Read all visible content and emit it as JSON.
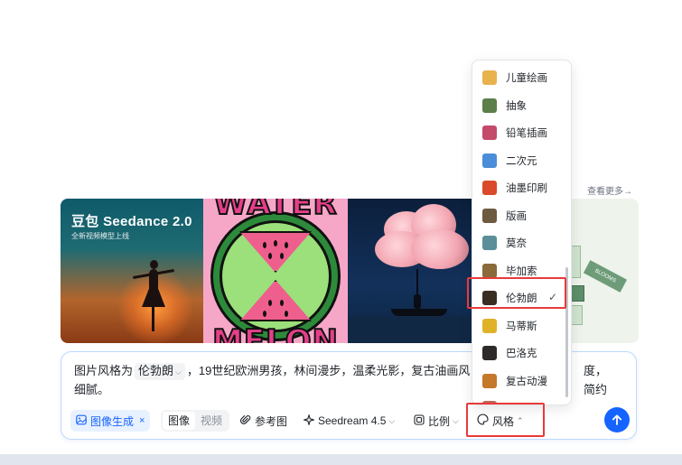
{
  "view_more": "查看更多→",
  "banner": {
    "title": "豆包 Seedance 2.0",
    "subtitle": "全新视频模型上线"
  },
  "card2": {
    "top_word": "WATER",
    "bottom_word": "MELON"
  },
  "card4": {
    "sign": "BLOOMS"
  },
  "prompt": {
    "prefix": "图片风格为",
    "chip": "伦勃朗",
    "chip_chevron": "⌵",
    "line1_rest": "，19世纪欧洲男孩，林间漫步，温柔光影，复古油画风",
    "tail": "度，简约",
    "line2": "细腻。"
  },
  "toolbar": {
    "image_gen_label": "图像生成",
    "image_gen_close": "×",
    "image_gen_icon": "image-icon",
    "mode_image": "图像",
    "mode_video": "视频",
    "ref_label": "参考图",
    "ref_icon": "paperclip-icon",
    "model_label": "Seedream 4.5",
    "model_icon": "sparkle-icon",
    "ratio_label": "比例",
    "ratio_icon": "aspect-ratio-icon",
    "style_label": "风格",
    "style_icon": "palette-icon"
  },
  "send_icon": "arrow-up-icon",
  "style_menu": {
    "items": [
      {
        "label": "儿童绘画",
        "thumb": "#e8b24d"
      },
      {
        "label": "抽象",
        "thumb": "#5c7f4a"
      },
      {
        "label": "铅笔插画",
        "thumb": "#c44a6a"
      },
      {
        "label": "二次元",
        "thumb": "#4a8ed9"
      },
      {
        "label": "油墨印刷",
        "thumb": "#d94a2a"
      },
      {
        "label": "版画",
        "thumb": "#6e5a40"
      },
      {
        "label": "莫奈",
        "thumb": "#5a8f9a"
      },
      {
        "label": "毕加索",
        "thumb": "#8a6a3a"
      },
      {
        "label": "伦勃朗",
        "thumb": "#3a2e22"
      },
      {
        "label": "马蒂斯",
        "thumb": "#e0b22a"
      },
      {
        "label": "巴洛克",
        "thumb": "#2e2a2a"
      },
      {
        "label": "复古动漫",
        "thumb": "#c4782a"
      },
      {
        "label": "",
        "thumb": "#b86a5a"
      }
    ],
    "selected": "伦勃朗",
    "check": "✓"
  },
  "colors": {
    "accent": "#1664ff",
    "highlight": "#e83a3a"
  }
}
